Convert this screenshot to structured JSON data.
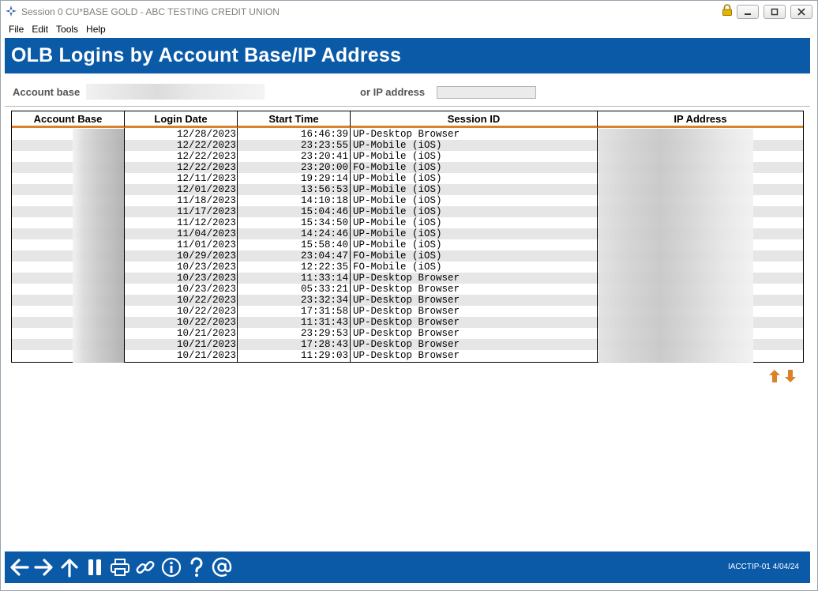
{
  "window": {
    "title": "Session 0 CU*BASE GOLD - ABC TESTING CREDIT UNION"
  },
  "menu": [
    "File",
    "Edit",
    "Tools",
    "Help"
  ],
  "header": {
    "title": "OLB Logins by Account Base/IP Address"
  },
  "search": {
    "account_base_label": "Account base",
    "ip_label": "or IP address",
    "ip_value": ""
  },
  "table": {
    "columns": [
      "Account Base",
      "Login Date",
      "Start Time",
      "Session ID",
      "IP Address"
    ],
    "rows": [
      {
        "date": "12/28/2023",
        "time": "16:46:39",
        "session": "UP-Desktop Browser"
      },
      {
        "date": "12/22/2023",
        "time": "23:23:55",
        "session": "UP-Mobile (iOS)"
      },
      {
        "date": "12/22/2023",
        "time": "23:20:41",
        "session": "UP-Mobile (iOS)"
      },
      {
        "date": "12/22/2023",
        "time": "23:20:00",
        "session": "FO-Mobile (iOS)"
      },
      {
        "date": "12/11/2023",
        "time": "19:29:14",
        "session": "UP-Mobile (iOS)"
      },
      {
        "date": "12/01/2023",
        "time": "13:56:53",
        "session": "UP-Mobile (iOS)"
      },
      {
        "date": "11/18/2023",
        "time": "14:10:18",
        "session": "UP-Mobile (iOS)"
      },
      {
        "date": "11/17/2023",
        "time": "15:04:46",
        "session": "UP-Mobile (iOS)"
      },
      {
        "date": "11/12/2023",
        "time": "15:34:50",
        "session": "UP-Mobile (iOS)"
      },
      {
        "date": "11/04/2023",
        "time": "14:24:46",
        "session": "UP-Mobile (iOS)"
      },
      {
        "date": "11/01/2023",
        "time": "15:58:40",
        "session": "UP-Mobile (iOS)"
      },
      {
        "date": "10/29/2023",
        "time": "23:04:47",
        "session": "FO-Mobile (iOS)"
      },
      {
        "date": "10/23/2023",
        "time": "12:22:35",
        "session": "FO-Mobile (iOS)"
      },
      {
        "date": "10/23/2023",
        "time": "11:33:14",
        "session": "UP-Desktop Browser"
      },
      {
        "date": "10/23/2023",
        "time": "05:33:21",
        "session": "UP-Desktop Browser"
      },
      {
        "date": "10/22/2023",
        "time": "23:32:34",
        "session": "UP-Desktop Browser"
      },
      {
        "date": "10/22/2023",
        "time": "17:31:58",
        "session": "UP-Desktop Browser"
      },
      {
        "date": "10/22/2023",
        "time": "11:31:43",
        "session": "UP-Desktop Browser"
      },
      {
        "date": "10/21/2023",
        "time": "23:29:53",
        "session": "UP-Desktop Browser"
      },
      {
        "date": "10/21/2023",
        "time": "17:28:43",
        "session": "UP-Desktop Browser"
      },
      {
        "date": "10/21/2023",
        "time": "11:29:03",
        "session": "UP-Desktop Browser"
      }
    ]
  },
  "footer": {
    "screen_id": "IACCTIP-01 4/04/24",
    "tools": [
      "back-arrow-icon",
      "forward-arrow-icon",
      "up-arrow-icon",
      "pause-icon",
      "printer-icon",
      "link-icon",
      "info-icon",
      "help-icon",
      "at-icon"
    ]
  },
  "colors": {
    "brand_blue": "#0b5aa8",
    "accent_orange": "#d9822b",
    "row_alt": "#e6e6e6"
  }
}
